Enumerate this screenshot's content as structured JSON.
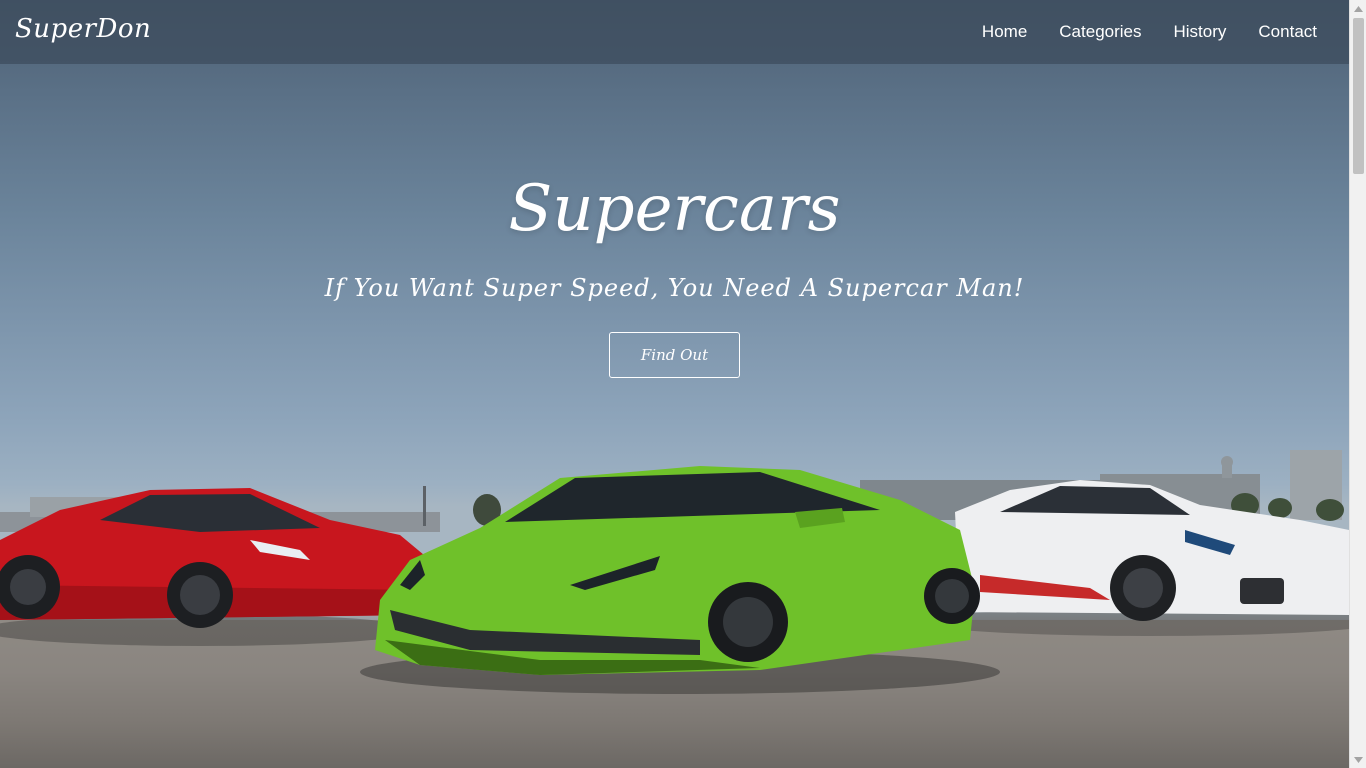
{
  "navbar": {
    "brand": "SuperDon",
    "links": [
      {
        "label": "Home"
      },
      {
        "label": "Categories"
      },
      {
        "label": "History"
      },
      {
        "label": "Contact"
      }
    ]
  },
  "hero": {
    "title": "Supercars",
    "subtitle": "If You Want Super Speed, You Need A Supercar Man!",
    "cta_label": "Find Out",
    "image_subject": "red, green and white supercars parked on tarmac under a blue sky"
  },
  "scrollbar": {
    "up_icon": "triangle-up-icon",
    "down_icon": "triangle-down-icon"
  }
}
